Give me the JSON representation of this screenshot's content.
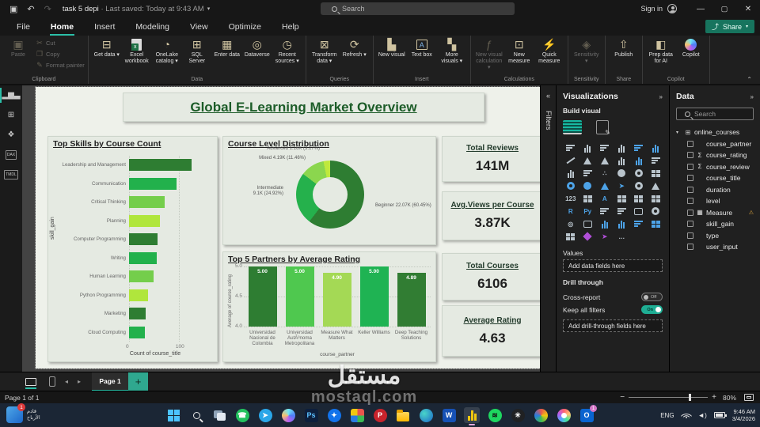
{
  "titlebar": {
    "title": "task 5 depi",
    "separator": "·",
    "subtitle": "Last saved: Today at 9:43 AM",
    "search_placeholder": "Search",
    "signin_label": "Sign in",
    "minimize": "—",
    "maximize": "▢",
    "close": "✕"
  },
  "menu": {
    "items": [
      "File",
      "Home",
      "Insert",
      "Modeling",
      "View",
      "Optimize",
      "Help"
    ],
    "active": "Home",
    "share_label": "Share"
  },
  "ribbon": {
    "groups": [
      {
        "label": "Clipboard",
        "buttons": [
          {
            "label": "Paste",
            "icon": "paste-icon",
            "glyph": "▣",
            "disabled": true
          },
          {
            "label": "Cut",
            "icon": "cut-icon",
            "glyph": "✂",
            "disabled": true,
            "small": true
          },
          {
            "label": "Copy",
            "icon": "copy-icon",
            "glyph": "❐",
            "disabled": true,
            "small": true
          },
          {
            "label": "Format painter",
            "icon": "format-painter-icon",
            "glyph": "✎",
            "disabled": true,
            "small": true
          }
        ]
      },
      {
        "label": "Data",
        "buttons": [
          {
            "label": "Get data",
            "icon": "get-data-icon",
            "glyph": "⊟",
            "dropdown": true
          },
          {
            "label": "Excel workbook",
            "icon": "excel-workbook-icon",
            "special": "excel"
          },
          {
            "label": "OneLake catalog",
            "icon": "onelake-catalog-icon",
            "glyph": "◔",
            "dropdown": true
          },
          {
            "label": "SQL Server",
            "icon": "sql-server-icon",
            "glyph": "⊞"
          },
          {
            "label": "Enter data",
            "icon": "enter-data-icon",
            "glyph": "▦"
          },
          {
            "label": "Dataverse",
            "icon": "dataverse-icon",
            "glyph": "◎"
          },
          {
            "label": "Recent sources",
            "icon": "recent-sources-icon",
            "glyph": "◷",
            "dropdown": true
          }
        ]
      },
      {
        "label": "Queries",
        "buttons": [
          {
            "label": "Transform data",
            "icon": "transform-data-icon",
            "glyph": "⊠",
            "dropdown": true
          },
          {
            "label": "Refresh",
            "icon": "refresh-icon",
            "glyph": "⟳",
            "dropdown": true
          }
        ]
      },
      {
        "label": "Insert",
        "buttons": [
          {
            "label": "New visual",
            "icon": "new-visual-icon",
            "glyph": "▙"
          },
          {
            "label": "Text box",
            "icon": "text-box-icon",
            "special": "boxA"
          },
          {
            "label": "More visuals",
            "icon": "more-visuals-icon",
            "glyph": "▚",
            "dropdown": true
          }
        ]
      },
      {
        "label": "Calculations",
        "buttons": [
          {
            "label": "New visual calculation",
            "icon": "new-visual-calculation-icon",
            "glyph": "ƒ",
            "dropdown": true,
            "disabled": true
          },
          {
            "label": "New measure",
            "icon": "new-measure-icon",
            "glyph": "⊡"
          },
          {
            "label": "Quick measure",
            "icon": "quick-measure-icon",
            "glyph": "⚡"
          }
        ]
      },
      {
        "label": "Sensitivity",
        "buttons": [
          {
            "label": "Sensitivity",
            "icon": "sensitivity-icon",
            "glyph": "◈",
            "dropdown": true,
            "disabled": true
          }
        ]
      },
      {
        "label": "Share",
        "buttons": [
          {
            "label": "Publish",
            "icon": "publish-icon",
            "glyph": "⇧"
          }
        ]
      },
      {
        "label": "Copilot",
        "buttons": [
          {
            "label": "Prep data for AI",
            "icon": "prep-data-for-ai-icon",
            "glyph": "◧"
          },
          {
            "label": "Copilot",
            "icon": "copilot-icon",
            "special": "copilot"
          }
        ]
      }
    ]
  },
  "left_nav": [
    {
      "name": "report-view",
      "glyph": "▂▆▃",
      "active": true
    },
    {
      "name": "table-view",
      "glyph": "⊞"
    },
    {
      "name": "model-view",
      "glyph": "❖"
    },
    {
      "name": "dax-query-view",
      "text": "DAX"
    },
    {
      "name": "tmdl-view",
      "text": "TMDL"
    }
  ],
  "filters_panel": {
    "label": "Filters"
  },
  "viz_panel": {
    "title": "Visualizations",
    "build_visual": "Build visual",
    "values_label": "Values",
    "add_fields_placeholder": "Add data fields here",
    "drill_through_label": "Drill through",
    "cross_report_label": "Cross-report",
    "cross_report_state": "Off",
    "keep_filters_label": "Keep all filters",
    "keep_filters_state": "On",
    "add_drill_placeholder": "Add drill-through fields here",
    "gallery": [
      {
        "name": "stacked-bar-chart",
        "kind": "bh"
      },
      {
        "name": "stacked-column-chart",
        "kind": "bv"
      },
      {
        "name": "clustered-bar-chart",
        "kind": "bh"
      },
      {
        "name": "clustered-column-chart",
        "kind": "bv"
      },
      {
        "name": "100-stacked-bar-chart",
        "kind": "bh",
        "accent": true
      },
      {
        "name": "100-stacked-column-chart",
        "kind": "bv",
        "accent": true
      },
      {
        "name": "line-chart",
        "kind": "ln"
      },
      {
        "name": "area-chart",
        "kind": "ar"
      },
      {
        "name": "stacked-area-chart",
        "kind": "ar"
      },
      {
        "name": "line-and-stacked-column-chart",
        "kind": "bv"
      },
      {
        "name": "line-and-clustered-column-chart",
        "kind": "bv",
        "accent": true
      },
      {
        "name": "ribbon-chart",
        "kind": "bh"
      },
      {
        "name": "waterfall-chart",
        "kind": "bv"
      },
      {
        "name": "funnel-chart",
        "kind": "bh"
      },
      {
        "name": "scatter-chart",
        "kind": "tx",
        "text": "∴"
      },
      {
        "name": "pie-chart",
        "kind": "pi"
      },
      {
        "name": "donut-chart",
        "kind": "do"
      },
      {
        "name": "treemap",
        "kind": "gr"
      },
      {
        "name": "map",
        "kind": "do",
        "accent": true
      },
      {
        "name": "filled-map",
        "kind": "pi",
        "accent": true
      },
      {
        "name": "shape-map",
        "kind": "ar",
        "accent": true
      },
      {
        "name": "azure-map",
        "kind": "aw",
        "accent": true
      },
      {
        "name": "gauge",
        "kind": "do"
      },
      {
        "name": "kpi",
        "kind": "ar"
      },
      {
        "name": "card",
        "kind": "tx",
        "text": "123"
      },
      {
        "name": "multi-row-card",
        "kind": "gr"
      },
      {
        "name": "smart-narrative",
        "kind": "tx",
        "text": "A",
        "accent": true
      },
      {
        "name": "table",
        "kind": "gr"
      },
      {
        "name": "matrix",
        "kind": "gr"
      },
      {
        "name": "paginated-report",
        "kind": "gr"
      },
      {
        "name": "r-script-visual",
        "kind": "tx",
        "text": "R",
        "accent": true
      },
      {
        "name": "python-visual",
        "kind": "tx",
        "text": "Py",
        "accent": true
      },
      {
        "name": "slicer",
        "kind": "bh"
      },
      {
        "name": "text-slicer",
        "kind": "bh"
      },
      {
        "name": "q-and-a",
        "kind": "bu"
      },
      {
        "name": "key-influencers",
        "kind": "do"
      },
      {
        "name": "metrics",
        "kind": "tx",
        "text": "◎"
      },
      {
        "name": "paginated-report-visual",
        "kind": "bu"
      },
      {
        "name": "power-apps-visual",
        "kind": "bv",
        "accent": true
      },
      {
        "name": "power-automate-visual",
        "kind": "bv",
        "accent": true
      },
      {
        "name": "arcgis-map",
        "kind": "bh",
        "accent": true
      },
      {
        "name": "azure-map-2",
        "kind": "gr",
        "accent": true
      },
      {
        "name": "more-grid",
        "kind": "gr"
      },
      {
        "name": "decomposition-tree",
        "kind": "di",
        "purple": true
      },
      {
        "name": "power-automate",
        "kind": "aw",
        "purple": true
      },
      {
        "name": "more-options",
        "kind": "tx",
        "text": "…"
      }
    ]
  },
  "data_panel": {
    "title": "Data",
    "search_placeholder": "Search",
    "table": "online_courses",
    "fields": [
      {
        "name": "course_partner"
      },
      {
        "name": "course_rating",
        "sum": true
      },
      {
        "name": "course_review",
        "sum": true
      },
      {
        "name": "course_title"
      },
      {
        "name": "duration"
      },
      {
        "name": "level"
      },
      {
        "name": "Measure",
        "measure": true,
        "warning": true
      },
      {
        "name": "skill_gain"
      },
      {
        "name": "type"
      },
      {
        "name": "user_input"
      }
    ]
  },
  "report": {
    "title": "Global E-Learning Market Overview",
    "kpis": [
      {
        "title": "Total Reviews",
        "value": "141M"
      },
      {
        "title": "Avg.Views per Course",
        "value": "3.87K"
      },
      {
        "title": "Total Courses",
        "value": "6106"
      },
      {
        "title": "Average Rating",
        "value": "4.63"
      }
    ]
  },
  "chart_data": [
    {
      "type": "bar",
      "orientation": "horizontal",
      "title": "Top Skills by Course Count",
      "categories": [
        "Leadership and Management",
        "Communication",
        "Critical Thinking",
        "Planning",
        "Computer Programming",
        "Writing",
        "Human Learning",
        "Python Programming",
        "Marketing",
        "Cloud Computing"
      ],
      "values": [
        125,
        95,
        72,
        62,
        57,
        55,
        50,
        38,
        34,
        32
      ],
      "xlabel": "Count of course_title",
      "ylabel": "skill_gain",
      "xticks": [
        0,
        100
      ],
      "xlim": [
        0,
        167
      ],
      "colors": [
        "#2e7d32",
        "#22b14c",
        "#74ce4b",
        "#b0e63c"
      ]
    },
    {
      "type": "donut",
      "title": "Course Level Distribution",
      "slices": [
        {
          "label": "Beginner",
          "value": "22.07K",
          "pct": 60.45,
          "color": "#2e7d32"
        },
        {
          "label": "Intermediate",
          "value": "9.1K",
          "pct": 24.92,
          "color": "#25b14c"
        },
        {
          "label": "Mixed",
          "value": "4.19K",
          "pct": 11.46,
          "color": "#8bd64e"
        },
        {
          "label": "Advanced",
          "value": "1.16K",
          "pct": 3.17,
          "color": "#bfe93c"
        }
      ]
    },
    {
      "type": "column",
      "title": "Top 5 Partners by Average Rating",
      "categories": [
        "Universidad Nacional de Colombia",
        "Universidad AutÃ³noma Metropolitana",
        "Measure What Matters",
        "Keller Williams",
        "Deep Teaching Solutions"
      ],
      "values": [
        5.0,
        5.0,
        4.9,
        5.0,
        4.89
      ],
      "labels": [
        "5.00",
        "5.00",
        "4.90",
        "5.00",
        "4.89"
      ],
      "colors": [
        "#2e7d32",
        "#4fc84f",
        "#a4d955",
        "#1fb353",
        "#317d33"
      ],
      "ylabel": "Average of course_rating",
      "xlabel": "course_partner",
      "yticks": [
        "5.0",
        "4.5",
        "4.0"
      ],
      "ylim": [
        4.0,
        5.0
      ]
    }
  ],
  "pagebar": {
    "page_tab": "Page 1"
  },
  "statusbar": {
    "left": "Page 1 of 1",
    "zoom": "80%"
  },
  "taskbar": {
    "widget": {
      "line1": "قادم",
      "line2": "الأرباح",
      "badge": "1"
    },
    "icons": [
      {
        "name": "start-icon",
        "kind": "win"
      },
      {
        "name": "search-icon",
        "kind": "search"
      },
      {
        "name": "task-view-icon",
        "kind": "taskview"
      },
      {
        "name": "whatsapp-icon",
        "kind": "circle",
        "bg": "#23c25e",
        "fg": "#fff",
        "text": "☎"
      },
      {
        "name": "telegram-icon",
        "kind": "circle",
        "bg": "#2aa6e8",
        "fg": "#fff",
        "text": "➤"
      },
      {
        "name": "copilot-icon",
        "kind": "grad",
        "grad": "conic-gradient(#6ee7f5,#4f7df7,#b95ef0,#f5c26e,#6ee7f5)"
      },
      {
        "name": "photoshop-icon",
        "kind": "square",
        "bg": "#0d1f3c",
        "fg": "#5cc1ff",
        "text": "Ps"
      },
      {
        "name": "blue-app-icon",
        "kind": "circle",
        "bg": "#1273eb",
        "fg": "#fff",
        "text": "✦"
      },
      {
        "name": "app-grid-icon",
        "kind": "pinwheel"
      },
      {
        "name": "pinterest-icon",
        "kind": "circle",
        "bg": "#c8232c",
        "fg": "#fff",
        "text": "P"
      },
      {
        "name": "file-explorer-icon",
        "kind": "folder"
      },
      {
        "name": "edge-icon",
        "kind": "grad",
        "grad": "radial-gradient(circle at 35% 35%, #49d6c8, #1b66c9)"
      },
      {
        "name": "word-icon",
        "kind": "square",
        "bg": "#1651b5",
        "fg": "#fff",
        "text": "W"
      },
      {
        "name": "power-bi-icon",
        "kind": "pbi",
        "active": true
      },
      {
        "name": "spotify-icon",
        "kind": "circle",
        "bg": "#1ed760",
        "fg": "#111",
        "text": "≋"
      },
      {
        "name": "chatgpt-icon",
        "kind": "circle",
        "bg": "#202123",
        "fg": "#fff",
        "text": "✳"
      },
      {
        "name": "microsoft-365-icon",
        "kind": "grad",
        "grad": "conic-gradient(#e8554d,#f2c80f,#3cba54,#2a7de1,#e8554d)"
      },
      {
        "name": "designer-icon",
        "kind": "grad",
        "grad": "conic-gradient(#ff5f6d,#ffc371,#47e891,#4fa8ff,#b95ef0,#ff5f6d)",
        "hole": true
      },
      {
        "name": "outlook-icon",
        "kind": "square",
        "bg": "#0a64d0",
        "fg": "#fff",
        "text": "O",
        "badge": "1"
      }
    ],
    "tray": {
      "lang": "ENG",
      "time": "9:46 AM",
      "date": "3/4/2026"
    }
  },
  "watermark": {
    "text": "مستقل",
    "url": "mostaql.com"
  }
}
